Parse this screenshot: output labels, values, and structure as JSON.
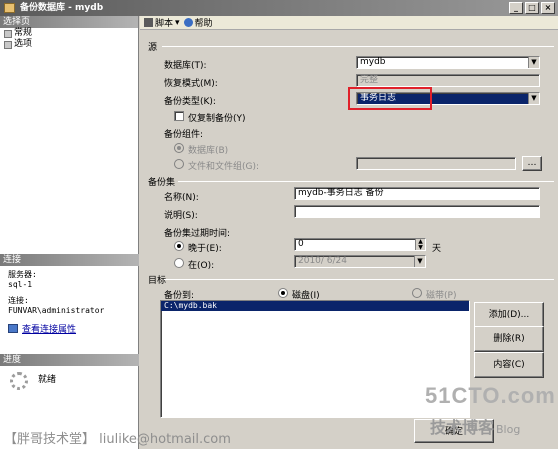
{
  "window": {
    "title": "备份数据库 - mydb",
    "controls": [
      "_",
      "□",
      "×"
    ]
  },
  "left_panel": {
    "select_page_header": "选择页",
    "pages": [
      {
        "label": "常规"
      },
      {
        "label": "选项"
      }
    ],
    "connection_header": "连接",
    "server_label": "服务器:",
    "server_value": "sql-1",
    "connection_label": "连接:",
    "connection_value": "FUNVAR\\administrator",
    "view_connection_properties": "查看连接属性",
    "progress_header": "进度",
    "progress_status": "就绪"
  },
  "toolbar": {
    "script_label": "脚本",
    "help_label": "帮助"
  },
  "source": {
    "group_label": "源",
    "database_label": "数据库(T):",
    "database_value": "mydb",
    "recovery_model_label": "恢复模式(M):",
    "recovery_model_value": "完整",
    "backup_type_label": "备份类型(K):",
    "backup_type_value": "事务日志",
    "copy_only_label": "仅复制备份(Y)",
    "backup_component_label": "备份组件:",
    "database_option": "数据库(B)",
    "files_option": "文件和文件组(G):"
  },
  "backup_set": {
    "group_label": "备份集",
    "name_label": "名称(N):",
    "name_value": "mydb-事务日志  备份",
    "description_label": "说明(S):",
    "description_value": "",
    "expire_label": "备份集过期时间:",
    "after_label": "晚于(E):",
    "after_value": "0",
    "days_label": "天",
    "on_label": "在(O):",
    "on_value": "2010/ 6/24"
  },
  "destination": {
    "group_label": "目标",
    "backup_to_label": "备份到:",
    "disk_option": "磁盘(I)",
    "tape_option": "磁带(P)",
    "entries": [
      "C:\\mydb.bak"
    ],
    "add_button": "添加(D)...",
    "remove_button": "删除(R)",
    "contents_button": "内容(C)"
  },
  "footer": {
    "ok_button": "确定"
  },
  "watermarks": {
    "left": "【胖哥技术堂】 liulike@hotmail.com",
    "site": "51CTO.com",
    "blog_cn": "技术博客",
    "blog_en": "Blog"
  },
  "colors": {
    "selection": "#0a246a",
    "highlight_box": "#e0202a"
  }
}
